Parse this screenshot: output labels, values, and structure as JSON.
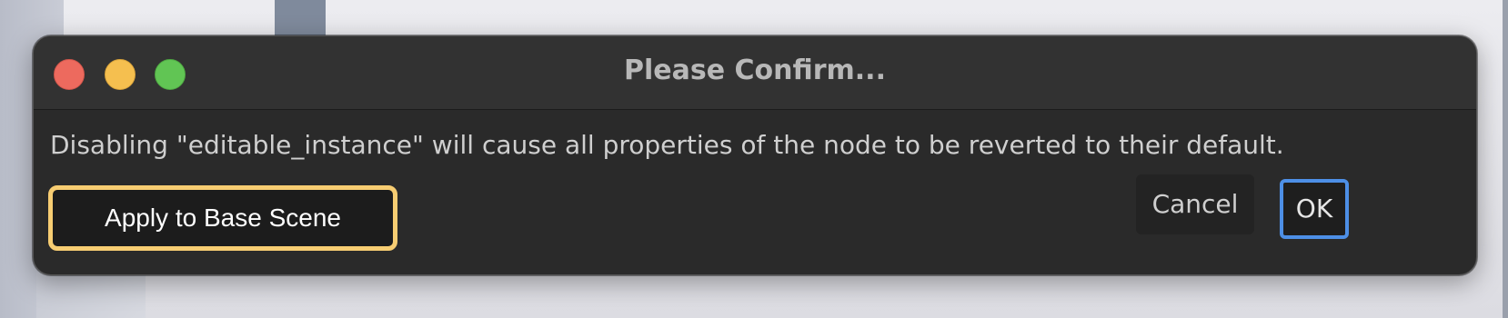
{
  "dialog": {
    "title": "Please Confirm...",
    "message": "Disabling \"editable_instance\" will cause all properties of the node to be reverted to their default.",
    "buttons": {
      "apply": "Apply to Base Scene",
      "cancel": "Cancel",
      "ok": "OK"
    },
    "window_controls": [
      {
        "name": "close",
        "icon": "red-circle",
        "color": "#ed6a5e"
      },
      {
        "name": "minimize",
        "icon": "yellow-circle",
        "color": "#f5bf4f"
      },
      {
        "name": "maximize",
        "icon": "green-circle",
        "color": "#61c554"
      }
    ]
  },
  "colors": {
    "dialog_background": "#2a2a2a",
    "titlebar_background": "#323232",
    "apply_highlight": "#f7cd72",
    "ok_focus": "#4d8fe6"
  }
}
